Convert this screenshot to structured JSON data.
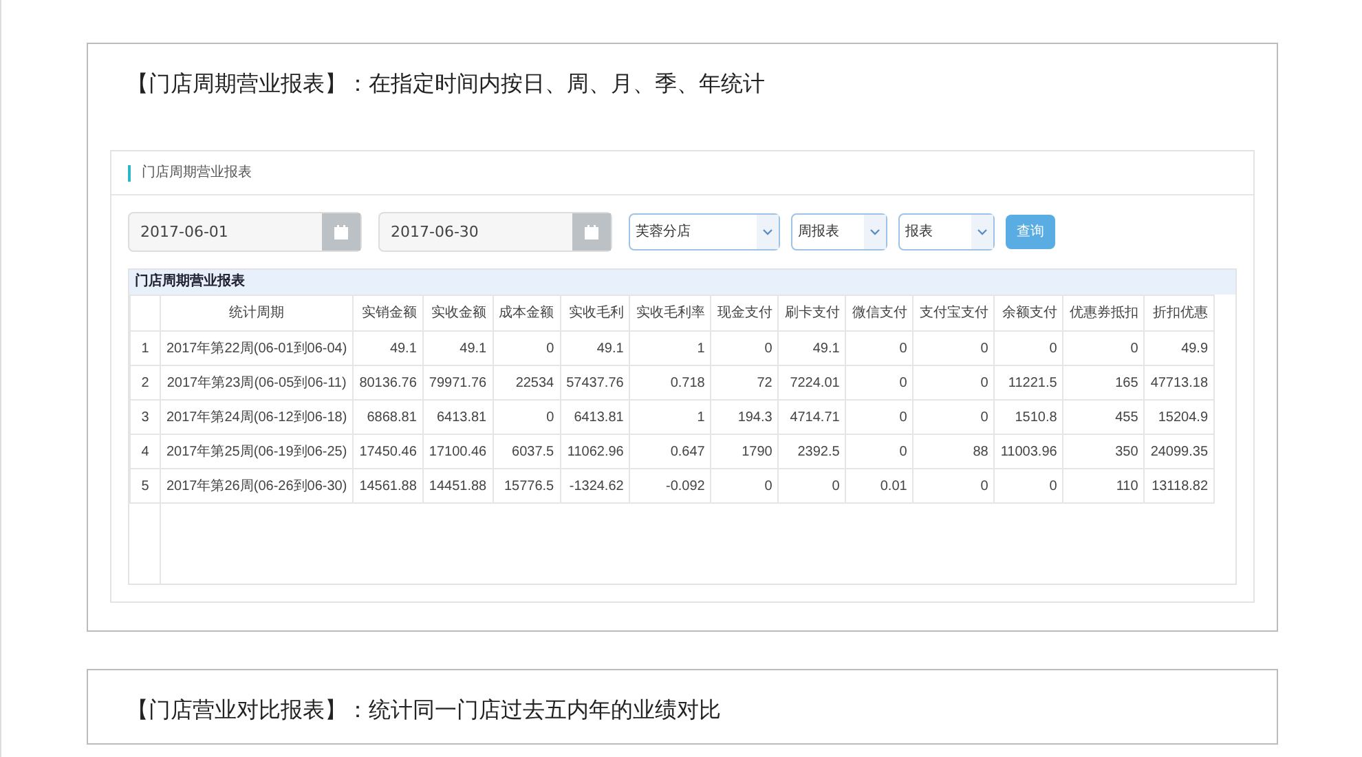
{
  "sections": [
    {
      "heading": "【门店周期营业报表】：在指定时间内按日、周、月、季、年统计",
      "panel": {
        "title": "门店周期营业报表",
        "filters": {
          "start_date": "2017-06-01",
          "end_date": "2017-06-30",
          "selects": [
            "芙蓉分店",
            "周报表",
            "报表"
          ],
          "query_button": "查询"
        },
        "table": {
          "caption": "门店周期营业报表",
          "columns": [
            "",
            "统计周期",
            "实销金额",
            "实收金额",
            "成本金额",
            "实收毛利",
            "实收毛利率",
            "现金支付",
            "刷卡支付",
            "微信支付",
            "支付宝支付",
            "余额支付",
            "优惠券抵扣",
            "折扣优惠"
          ],
          "rows": [
            [
              "1",
              "2017年第22周(06-01到06-04)",
              "49.1",
              "49.1",
              "0",
              "49.1",
              "1",
              "0",
              "49.1",
              "0",
              "0",
              "0",
              "0",
              "49.9"
            ],
            [
              "2",
              "2017年第23周(06-05到06-11)",
              "80136.76",
              "79971.76",
              "22534",
              "57437.76",
              "0.718",
              "72",
              "7224.01",
              "0",
              "0",
              "11221.5",
              "165",
              "47713.18"
            ],
            [
              "3",
              "2017年第24周(06-12到06-18)",
              "6868.81",
              "6413.81",
              "0",
              "6413.81",
              "1",
              "194.3",
              "4714.71",
              "0",
              "0",
              "1510.8",
              "455",
              "15204.9"
            ],
            [
              "4",
              "2017年第25周(06-19到06-25)",
              "17450.46",
              "17100.46",
              "6037.5",
              "11062.96",
              "0.647",
              "1790",
              "2392.5",
              "0",
              "88",
              "11003.96",
              "350",
              "24099.35"
            ],
            [
              "5",
              "2017年第26周(06-26到06-30)",
              "14561.88",
              "14451.88",
              "15776.5",
              "-1324.62",
              "-0.092",
              "0",
              "0",
              "0.01",
              "0",
              "0",
              "110",
              "13118.82"
            ]
          ]
        }
      }
    },
    {
      "heading": "【门店营业对比报表】：统计同一门店过去五内年的业绩对比"
    }
  ]
}
